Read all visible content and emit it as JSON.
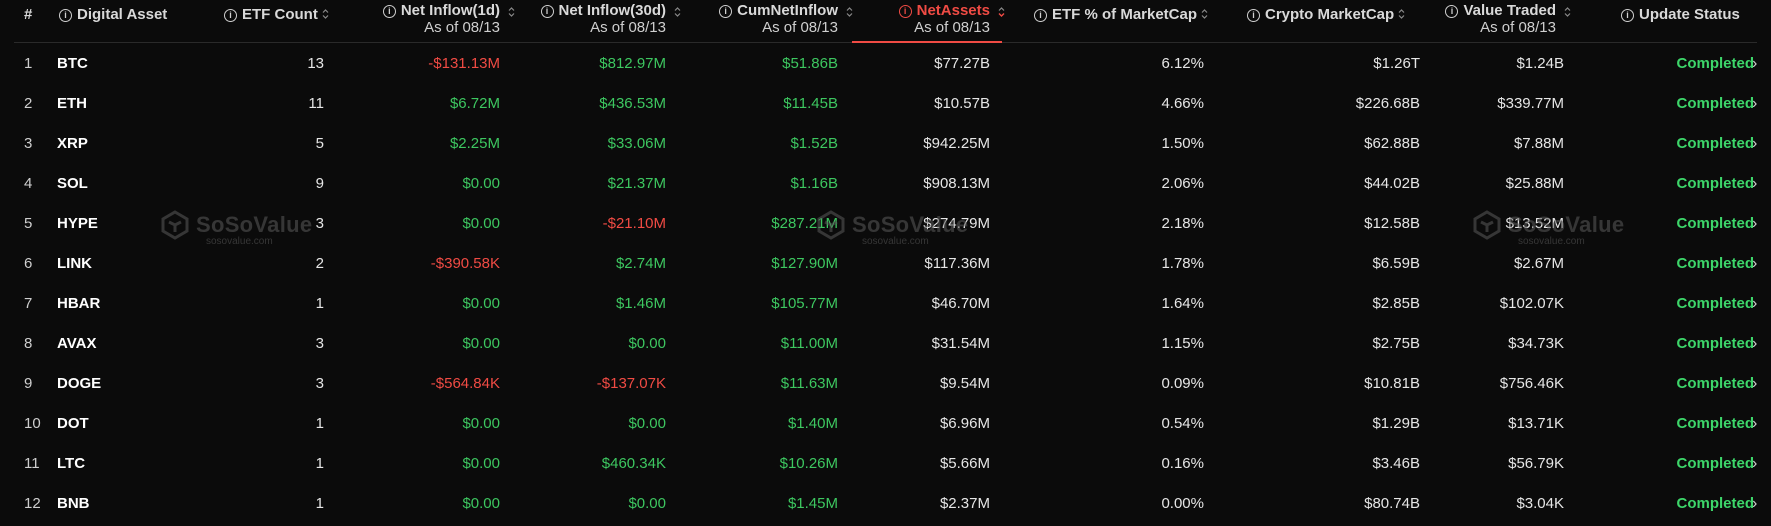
{
  "header": {
    "index": "#",
    "digital_asset": "Digital Asset",
    "etf_count": "ETF Count",
    "net_inflow_1d": "Net Inflow(1d)",
    "net_inflow_1d_sub": "As of 08/13",
    "net_inflow_30d": "Net Inflow(30d)",
    "net_inflow_30d_sub": "As of 08/13",
    "cum_net_inflow": "CumNetInflow",
    "cum_net_inflow_sub": "As of 08/13",
    "net_assets": "NetAssets",
    "net_assets_sub": "As of 08/13",
    "etf_pct_mcap": "ETF % of MarketCap",
    "crypto_mcap": "Crypto MarketCap",
    "value_traded": "Value Traded",
    "value_traded_sub": "As of 08/13",
    "update_status": "Update Status"
  },
  "watermark": {
    "name": "SoSoValue",
    "url": "sosovalue.com"
  },
  "colors": {
    "positive": "#3dc760",
    "negative": "#f04b44",
    "status": "#3dd66a",
    "active_sort": "#f04b44"
  },
  "rows": [
    {
      "index": "1",
      "asset": "BTC",
      "etf_count": "13",
      "inflow_1d": "-$131.13M",
      "inflow_1d_sign": "neg",
      "inflow_30d": "$812.97M",
      "inflow_30d_sign": "pos",
      "cum_inflow": "$51.86B",
      "cum_inflow_sign": "pos",
      "net_assets": "$77.27B",
      "etf_pct": "6.12%",
      "mcap": "$1.26T",
      "value_traded": "$1.24B",
      "status": "Completed"
    },
    {
      "index": "2",
      "asset": "ETH",
      "etf_count": "11",
      "inflow_1d": "$6.72M",
      "inflow_1d_sign": "pos",
      "inflow_30d": "$436.53M",
      "inflow_30d_sign": "pos",
      "cum_inflow": "$11.45B",
      "cum_inflow_sign": "pos",
      "net_assets": "$10.57B",
      "etf_pct": "4.66%",
      "mcap": "$226.68B",
      "value_traded": "$339.77M",
      "status": "Completed"
    },
    {
      "index": "3",
      "asset": "XRP",
      "etf_count": "5",
      "inflow_1d": "$2.25M",
      "inflow_1d_sign": "pos",
      "inflow_30d": "$33.06M",
      "inflow_30d_sign": "pos",
      "cum_inflow": "$1.52B",
      "cum_inflow_sign": "pos",
      "net_assets": "$942.25M",
      "etf_pct": "1.50%",
      "mcap": "$62.88B",
      "value_traded": "$7.88M",
      "status": "Completed"
    },
    {
      "index": "4",
      "asset": "SOL",
      "etf_count": "9",
      "inflow_1d": "$0.00",
      "inflow_1d_sign": "pos",
      "inflow_30d": "$21.37M",
      "inflow_30d_sign": "pos",
      "cum_inflow": "$1.16B",
      "cum_inflow_sign": "pos",
      "net_assets": "$908.13M",
      "etf_pct": "2.06%",
      "mcap": "$44.02B",
      "value_traded": "$25.88M",
      "status": "Completed"
    },
    {
      "index": "5",
      "asset": "HYPE",
      "etf_count": "3",
      "inflow_1d": "$0.00",
      "inflow_1d_sign": "pos",
      "inflow_30d": "-$21.10M",
      "inflow_30d_sign": "neg",
      "cum_inflow": "$287.21M",
      "cum_inflow_sign": "pos",
      "net_assets": "$274.79M",
      "etf_pct": "2.18%",
      "mcap": "$12.58B",
      "value_traded": "$13.52M",
      "status": "Completed"
    },
    {
      "index": "6",
      "asset": "LINK",
      "etf_count": "2",
      "inflow_1d": "-$390.58K",
      "inflow_1d_sign": "neg",
      "inflow_30d": "$2.74M",
      "inflow_30d_sign": "pos",
      "cum_inflow": "$127.90M",
      "cum_inflow_sign": "pos",
      "net_assets": "$117.36M",
      "etf_pct": "1.78%",
      "mcap": "$6.59B",
      "value_traded": "$2.67M",
      "status": "Completed"
    },
    {
      "index": "7",
      "asset": "HBAR",
      "etf_count": "1",
      "inflow_1d": "$0.00",
      "inflow_1d_sign": "pos",
      "inflow_30d": "$1.46M",
      "inflow_30d_sign": "pos",
      "cum_inflow": "$105.77M",
      "cum_inflow_sign": "pos",
      "net_assets": "$46.70M",
      "etf_pct": "1.64%",
      "mcap": "$2.85B",
      "value_traded": "$102.07K",
      "status": "Completed"
    },
    {
      "index": "8",
      "asset": "AVAX",
      "etf_count": "3",
      "inflow_1d": "$0.00",
      "inflow_1d_sign": "pos",
      "inflow_30d": "$0.00",
      "inflow_30d_sign": "pos",
      "cum_inflow": "$11.00M",
      "cum_inflow_sign": "pos",
      "net_assets": "$31.54M",
      "etf_pct": "1.15%",
      "mcap": "$2.75B",
      "value_traded": "$34.73K",
      "status": "Completed"
    },
    {
      "index": "9",
      "asset": "DOGE",
      "etf_count": "3",
      "inflow_1d": "-$564.84K",
      "inflow_1d_sign": "neg",
      "inflow_30d": "-$137.07K",
      "inflow_30d_sign": "neg",
      "cum_inflow": "$11.63M",
      "cum_inflow_sign": "pos",
      "net_assets": "$9.54M",
      "etf_pct": "0.09%",
      "mcap": "$10.81B",
      "value_traded": "$756.46K",
      "status": "Completed"
    },
    {
      "index": "10",
      "asset": "DOT",
      "etf_count": "1",
      "inflow_1d": "$0.00",
      "inflow_1d_sign": "pos",
      "inflow_30d": "$0.00",
      "inflow_30d_sign": "pos",
      "cum_inflow": "$1.40M",
      "cum_inflow_sign": "pos",
      "net_assets": "$6.96M",
      "etf_pct": "0.54%",
      "mcap": "$1.29B",
      "value_traded": "$13.71K",
      "status": "Completed"
    },
    {
      "index": "11",
      "asset": "LTC",
      "etf_count": "1",
      "inflow_1d": "$0.00",
      "inflow_1d_sign": "pos",
      "inflow_30d": "$460.34K",
      "inflow_30d_sign": "pos",
      "cum_inflow": "$10.26M",
      "cum_inflow_sign": "pos",
      "net_assets": "$5.66M",
      "etf_pct": "0.16%",
      "mcap": "$3.46B",
      "value_traded": "$56.79K",
      "status": "Completed"
    },
    {
      "index": "12",
      "asset": "BNB",
      "etf_count": "1",
      "inflow_1d": "$0.00",
      "inflow_1d_sign": "pos",
      "inflow_30d": "$0.00",
      "inflow_30d_sign": "pos",
      "cum_inflow": "$1.45M",
      "cum_inflow_sign": "pos",
      "net_assets": "$2.37M",
      "etf_pct": "0.00%",
      "mcap": "$80.74B",
      "value_traded": "$3.04K",
      "status": "Completed"
    }
  ]
}
